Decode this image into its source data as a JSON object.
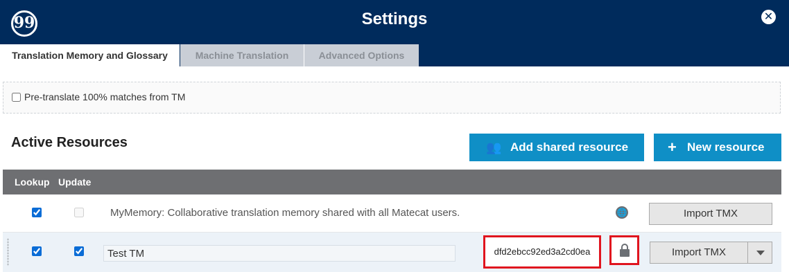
{
  "header": {
    "logo_glyph": "99",
    "title": "Settings",
    "close_glyph": "✕"
  },
  "tabs": [
    {
      "label": "Translation Memory and Glossary",
      "active": true
    },
    {
      "label": "Machine Translation",
      "active": false
    },
    {
      "label": "Advanced Options",
      "active": false
    }
  ],
  "pretranslate": {
    "label": "Pre-translate 100% matches from TM",
    "checked": false
  },
  "resources": {
    "title": "Active Resources",
    "add_shared_label": "Add shared resource",
    "new_resource_label": "New resource"
  },
  "table": {
    "columns": [
      "Lookup",
      "Update"
    ],
    "rows": [
      {
        "lookup": true,
        "update": false,
        "description": "MyMemory: Collaborative translation memory shared with all Matecat users.",
        "icon": "globe-icon",
        "action": "Import TMX"
      },
      {
        "lookup": true,
        "update": true,
        "name": "Test TM",
        "key": "dfd2ebcc92ed3a2cd0ea",
        "icon": "lock-icon",
        "action": "Import TMX"
      }
    ]
  },
  "colors": {
    "header_bg": "#002b5c",
    "accent_blue": "#0f8fc6",
    "table_header_bg": "#6e6f72",
    "highlight_red": "#e0141e"
  }
}
